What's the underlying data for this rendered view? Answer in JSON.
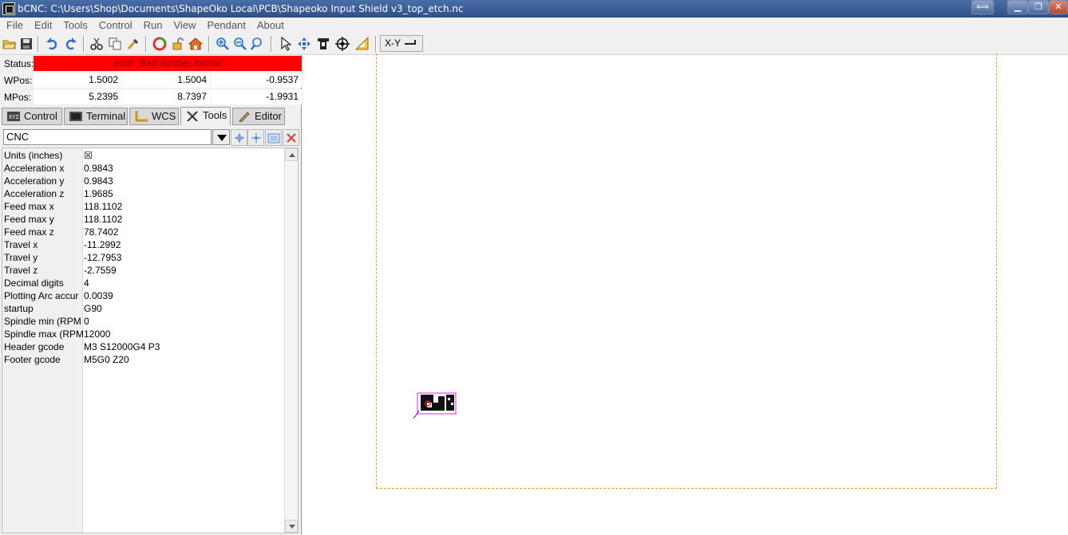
{
  "window": {
    "title": "bCNC: C:\\Users\\Shop\\Documents\\ShapeOko Local\\PCB\\Shapeoko Input Shield v3_top_etch.nc"
  },
  "menu": [
    "File",
    "Edit",
    "Tools",
    "Control",
    "Run",
    "View",
    "Pendant",
    "About"
  ],
  "toolbar": {
    "view_select": "X-Y",
    "icons": [
      "open-icon",
      "save-icon",
      "undo-icon",
      "redo-icon",
      "cut-icon",
      "copy-icon",
      "paste-icon",
      "reload-icon",
      "unlock-icon",
      "home-icon",
      "zoom-in-icon",
      "zoom-out-icon",
      "zoom-fit-icon",
      "select-icon",
      "move-icon",
      "gantry-icon",
      "origin-icon",
      "ruler-icon"
    ]
  },
  "state": {
    "status_label": "Status:",
    "status_text": "error: Bad number format",
    "status_color": "#ff0000",
    "wpos_label": "WPos:",
    "wpos": {
      "x": "1.5002",
      "y": "1.5004",
      "z": "-0.9537"
    },
    "mpos_label": "MPos:",
    "mpos": {
      "x": "5.2395",
      "y": "8.7397",
      "z": "-1.9931"
    }
  },
  "tabs": [
    {
      "label": "Control",
      "active": false
    },
    {
      "label": "Terminal",
      "active": false
    },
    {
      "label": "WCS",
      "active": false
    },
    {
      "label": "Tools",
      "active": true
    },
    {
      "label": "Editor",
      "active": false
    }
  ],
  "tools": {
    "combo_value": "CNC",
    "config": [
      {
        "key": "Units (inches)",
        "value": "☒"
      },
      {
        "key": "Acceleration x",
        "value": "0.9843"
      },
      {
        "key": "Acceleration y",
        "value": "0.9843"
      },
      {
        "key": "Acceleration z",
        "value": "1.9685"
      },
      {
        "key": "Feed max x",
        "value": "118.1102"
      },
      {
        "key": "Feed max y",
        "value": "118.1102"
      },
      {
        "key": "Feed max z",
        "value": "78.7402"
      },
      {
        "key": "Travel x",
        "value": "-11.2992"
      },
      {
        "key": "Travel y",
        "value": "-12.7953"
      },
      {
        "key": "Travel z",
        "value": "-2.7559"
      },
      {
        "key": "Decimal digits",
        "value": "4"
      },
      {
        "key": "Plotting Arc accur",
        "value": "0.0039"
      },
      {
        "key": "startup",
        "value": "G90"
      },
      {
        "key": "Spindle min (RPM",
        "value": "0"
      },
      {
        "key": "Spindle max (RPM",
        "value": "12000"
      },
      {
        "key": "Header gcode",
        "value": "M3 S12000G4 P3"
      },
      {
        "key": "Footer gcode",
        "value": "M5G0 Z20"
      }
    ]
  }
}
